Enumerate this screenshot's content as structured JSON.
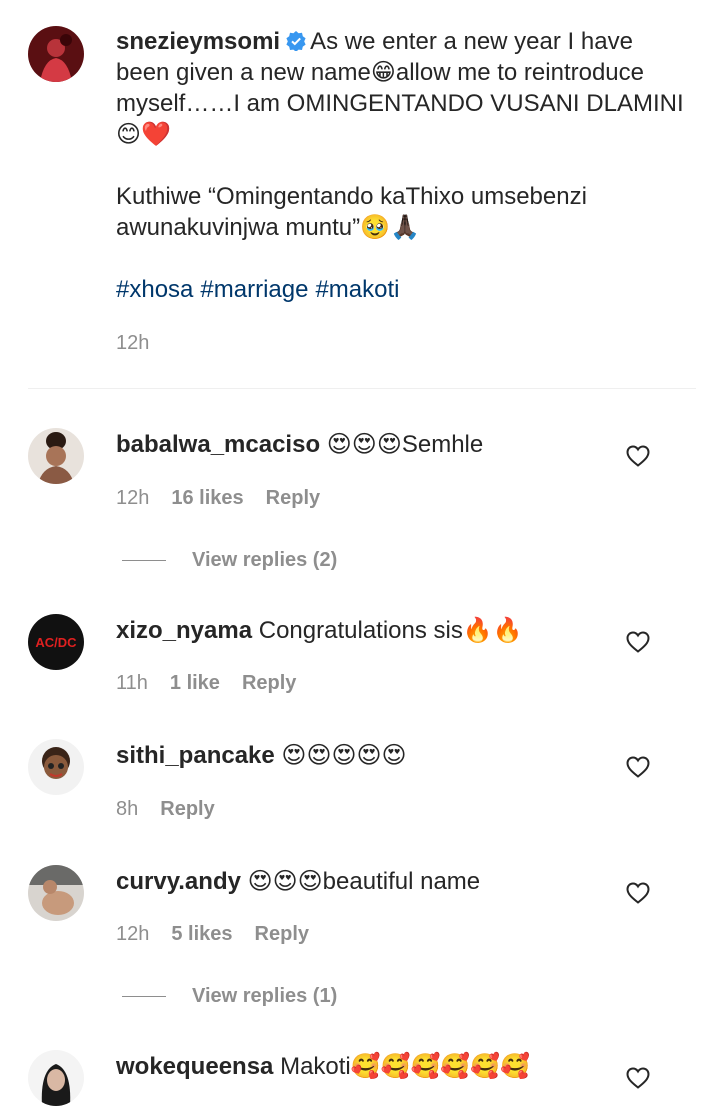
{
  "post": {
    "username": "snezieymsomi",
    "verified_icon": "verified-badge-icon",
    "caption_line1": "As we enter a new year I have been given a new name😁allow me to reintroduce myself……I am OMINGENTANDO VUSANI DLAMINI😊❤️",
    "caption_line2": "Kuthiwe “Omingentando kaThixo umsebenzi awunakuvinjwa muntu”🥹🙏🏿",
    "hashtags": [
      "#xhosa",
      "#marriage",
      "#makoti"
    ],
    "time": "12h"
  },
  "comments": [
    {
      "username": "babalwa_mcaciso",
      "text": "😍😍😍Semhle",
      "time": "12h",
      "likes": "16 likes",
      "reply": "Reply",
      "view_replies": "View replies (2)"
    },
    {
      "username": "xizo_nyama",
      "text": "Congratulations sis🔥🔥",
      "time": "11h",
      "likes": "1 like",
      "reply": "Reply",
      "avatar_text": "AC/DC"
    },
    {
      "username": "sithi_pancake",
      "text": "😍😍😍😍😍",
      "time": "8h",
      "reply": "Reply"
    },
    {
      "username": "curvy.andy",
      "text": "😍😍😍beautiful name",
      "time": "12h",
      "likes": "5 likes",
      "reply": "Reply",
      "view_replies": "View replies (1)"
    },
    {
      "username": "wokequeensa",
      "text": "Makoti🥰🥰🥰🥰🥰🥰"
    }
  ],
  "colors": {
    "text": "#262626",
    "secondary": "#8e8e8e",
    "hashtag": "#00376b",
    "verified": "#3897f0"
  },
  "icons": [
    "heart-icon",
    "verified-badge-icon"
  ]
}
